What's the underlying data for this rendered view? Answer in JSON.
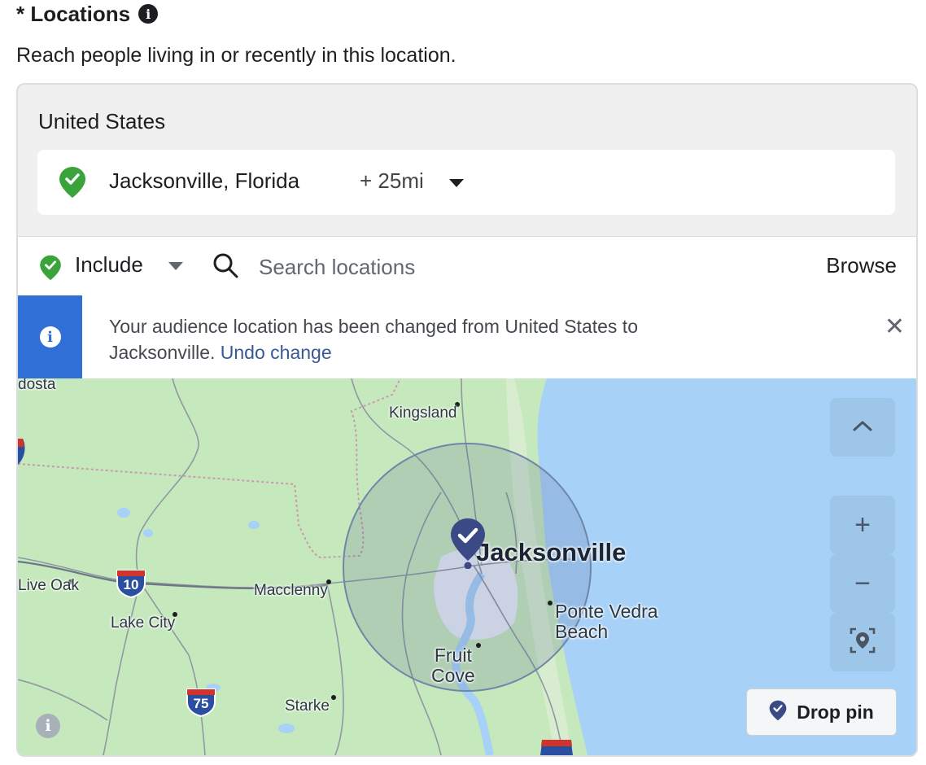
{
  "header": {
    "title": "* Locations",
    "subtitle": "Reach people living in or recently in this location."
  },
  "selected": {
    "country": "United States",
    "location": "Jacksonville, Florida",
    "radius": "+ 25mi"
  },
  "search": {
    "mode": "Include",
    "placeholder": "Search locations",
    "browse_label": "Browse"
  },
  "notice": {
    "message": "Your audience location has been changed from United States to Jacksonville.",
    "undo_label": "Undo change"
  },
  "map": {
    "labels": {
      "valdosta": "dosta",
      "kingsland": "Kingsland",
      "live_oak": "Live Oak",
      "macclenny": "Macclenny",
      "lake_city": "Lake City",
      "starke": "Starke",
      "jacksonville": "Jacksonville",
      "ponte_vedra_1": "Ponte Vedra",
      "ponte_vedra_2": "Beach",
      "fruit_cove_1": "Fruit",
      "fruit_cove_2": "Cove"
    },
    "shields": {
      "i10": "10",
      "i75": "75"
    },
    "controls": {
      "zoom_in": "+",
      "zoom_out": "−"
    },
    "drop_pin_label": "Drop pin"
  },
  "colors": {
    "accent_blue": "#2f6fd6",
    "link_blue": "#385898",
    "pin_navy": "#3b4a86",
    "include_green": "#3aa33a",
    "land_green": "#c6e8bd",
    "water_blue": "#a8d1f7"
  }
}
